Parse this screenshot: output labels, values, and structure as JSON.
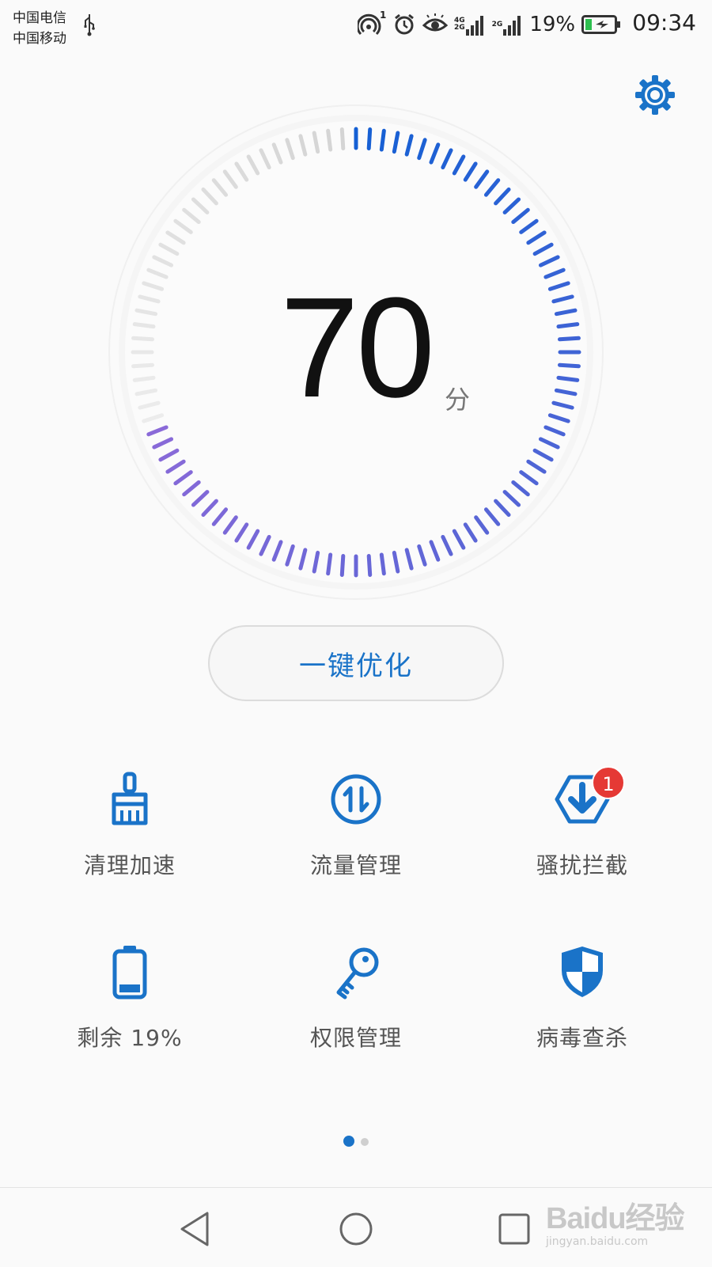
{
  "status_bar": {
    "carrier_1": "中国电信",
    "carrier_2": "中国移动",
    "hotspot_count": "1",
    "network_tag_1": "4G",
    "network_tag_2": "2G",
    "network_tag_3": "2G",
    "battery_percent": "19%",
    "time": "09:34"
  },
  "score": {
    "value": "70",
    "unit": "分",
    "fraction": 0.7
  },
  "optimize_button": {
    "label": "一键优化"
  },
  "tools": [
    {
      "label": "清理加速",
      "icon": "broom-icon"
    },
    {
      "label": "流量管理",
      "icon": "data-traffic-icon"
    },
    {
      "label": "骚扰拦截",
      "icon": "block-shield-icon",
      "badge": "1"
    },
    {
      "label": "剩余 19%",
      "icon": "battery-icon"
    },
    {
      "label": "权限管理",
      "icon": "key-icon"
    },
    {
      "label": "病毒查杀",
      "icon": "virus-shield-icon"
    }
  ],
  "pager": {
    "current": 1,
    "total": 2
  },
  "watermark": {
    "logo": "Baidu经验",
    "sub": "jingyan.baidu.com"
  },
  "colors": {
    "accent": "#1a73c8",
    "gauge_start": "#1560d4",
    "gauge_end": "#8a6ad8",
    "gauge_inactive": "#dddddd",
    "badge": "#e53935"
  }
}
